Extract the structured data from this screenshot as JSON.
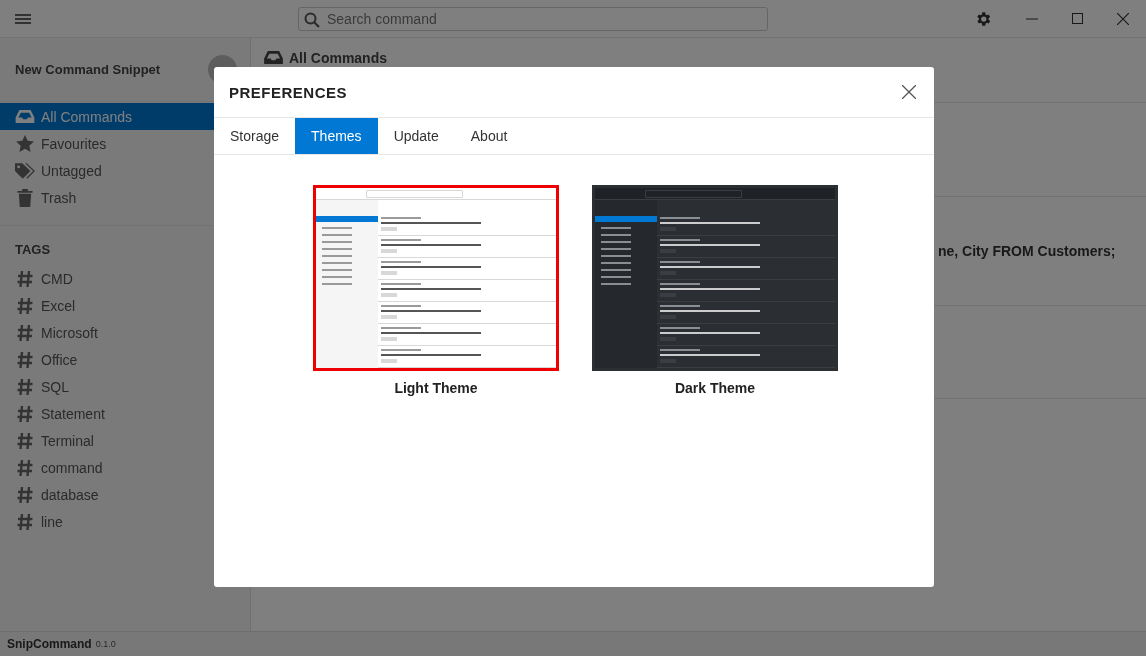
{
  "search": {
    "placeholder": "Search command"
  },
  "sidebar": {
    "new_snippet": "New Command Snippet",
    "items": [
      {
        "label": "All Commands",
        "selected": true
      },
      {
        "label": "Favourites",
        "selected": false
      },
      {
        "label": "Untagged",
        "selected": false
      },
      {
        "label": "Trash",
        "selected": false
      }
    ],
    "tags_heading": "TAGS",
    "tags": [
      "CMD",
      "Excel",
      "Microsoft",
      "Office",
      "SQL",
      "Statement",
      "Terminal",
      "command",
      "database",
      "line"
    ]
  },
  "main": {
    "title": "All Commands",
    "snippet_text": "ne, City FROM Customers;"
  },
  "status_bar": {
    "app_name": "SnipCommand",
    "version": "0.1.0"
  },
  "dialog": {
    "title": "PREFERENCES",
    "tabs": [
      {
        "label": "Storage",
        "selected": false
      },
      {
        "label": "Themes",
        "selected": true
      },
      {
        "label": "Update",
        "selected": false
      },
      {
        "label": "About",
        "selected": false
      }
    ],
    "themes": [
      {
        "label": "Light Theme",
        "kind": "light",
        "selected": true
      },
      {
        "label": "Dark Theme",
        "kind": "dark",
        "selected": false
      }
    ]
  }
}
